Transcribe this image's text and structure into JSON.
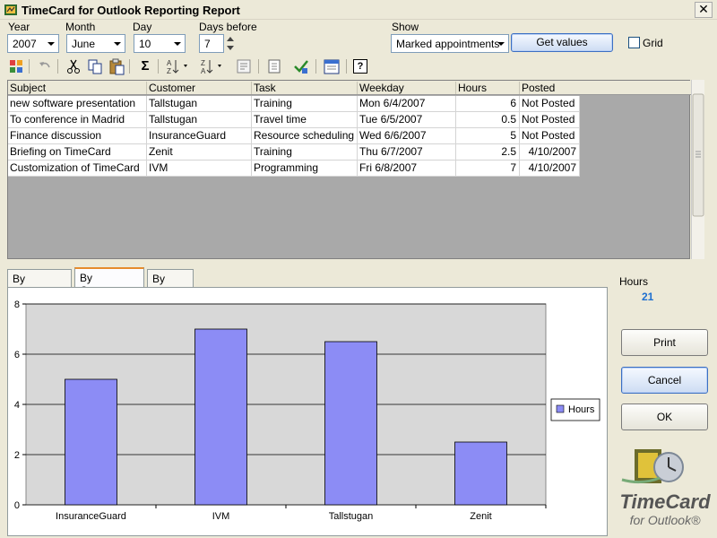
{
  "window": {
    "title": "TimeCard for Outlook Reporting Report",
    "close_glyph": "✕"
  },
  "filters": {
    "year_label": "Year",
    "year_value": "2007",
    "month_label": "Month",
    "month_value": "June",
    "day_label": "Day",
    "day_value": "10",
    "days_before_label": "Days before",
    "days_before_value": "7",
    "show_label": "Show",
    "show_value": "Marked appointments",
    "get_values_label": "Get values",
    "grid_label": "Grid"
  },
  "toolbar": {
    "icons": [
      "outlook-categories-icon",
      "undo-icon",
      "cut-icon",
      "copy-icon",
      "paste-icon",
      "sum-icon",
      "sort-ascending-icon",
      "sort-descending-icon",
      "filter-icon",
      "export-icon",
      "check-icon",
      "calendar-icon",
      "help-icon"
    ],
    "sum_glyph": "Σ",
    "help_glyph": "?"
  },
  "table": {
    "columns": [
      "Subject",
      "Customer",
      "Task",
      "Weekday",
      "Hours",
      "Posted"
    ],
    "rows": [
      [
        "new software presentation",
        "Tallstugan",
        "Training",
        "Mon 6/4/2007",
        "6",
        "Not Posted"
      ],
      [
        "To conference in Madrid",
        "Tallstugan",
        "Travel time",
        "Tue 6/5/2007",
        "0.5",
        "Not Posted"
      ],
      [
        "Finance discussion",
        "InsuranceGuard",
        "Resource scheduling",
        "Wed 6/6/2007",
        "5",
        "Not Posted"
      ],
      [
        "Briefing on TimeCard",
        "Zenit",
        "Training",
        "Thu 6/7/2007",
        "2.5",
        "4/10/2007"
      ],
      [
        "Customization of TimeCard",
        "IVM",
        "Programming",
        "Fri 6/8/2007",
        "7",
        "4/10/2007"
      ]
    ]
  },
  "tabs": [
    "By weekday",
    "By Customer",
    "By Task"
  ],
  "active_tab": "By Customer",
  "summary": {
    "hours_label": "Hours",
    "hours_value": "21"
  },
  "buttons": {
    "print": "Print",
    "cancel": "Cancel",
    "ok": "OK"
  },
  "logo": {
    "line1": "TimeCard",
    "line2": "for Outlook®"
  },
  "colors": {
    "bar": "#8c8cf5",
    "plot_bg": "#d8d8d8",
    "accent_blue": "#1e6fd0",
    "tab_accent": "#e68b2c"
  },
  "chart_data": {
    "type": "bar",
    "categories": [
      "InsuranceGuard",
      "IVM",
      "Tallstugan",
      "Zenit"
    ],
    "series": [
      {
        "name": "Hours",
        "values": [
          5,
          7,
          6.5,
          2.5
        ]
      }
    ],
    "ylim": [
      0,
      8
    ],
    "yticks": [
      0,
      2,
      4,
      6,
      8
    ],
    "grid": true,
    "legend": "right"
  }
}
